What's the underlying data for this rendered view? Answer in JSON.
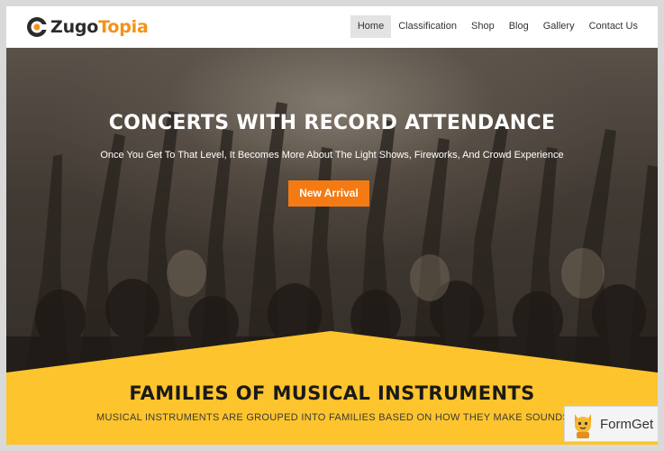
{
  "brand": {
    "name_part1": "Zugo",
    "name_part2": "Topia",
    "accent_color": "#f49219",
    "logo_icon": "target-c-icon"
  },
  "nav": {
    "items": [
      {
        "label": "Home",
        "active": true
      },
      {
        "label": "Classification",
        "active": false
      },
      {
        "label": "Shop",
        "active": false
      },
      {
        "label": "Blog",
        "active": false
      },
      {
        "label": "Gallery",
        "active": false
      },
      {
        "label": "Contact Us",
        "active": false
      }
    ]
  },
  "hero": {
    "title": "CONCERTS WITH RECORD ATTENDANCE",
    "subtitle": "Once You Get To That Level, It Becomes More About The Light Shows, Fireworks, And Crowd Experience",
    "button_label": "New Arrival",
    "button_color": "#f47b14"
  },
  "section": {
    "title": "FAMILIES OF MUSICAL INSTRUMENTS",
    "subtitle": "MUSICAL INSTRUMENTS ARE GROUPED INTO FAMILIES BASED ON HOW THEY MAKE SOUNDS",
    "background_color": "#fdc42d"
  },
  "badge": {
    "label": "FormGet",
    "icon": "cat-mascot-icon"
  }
}
